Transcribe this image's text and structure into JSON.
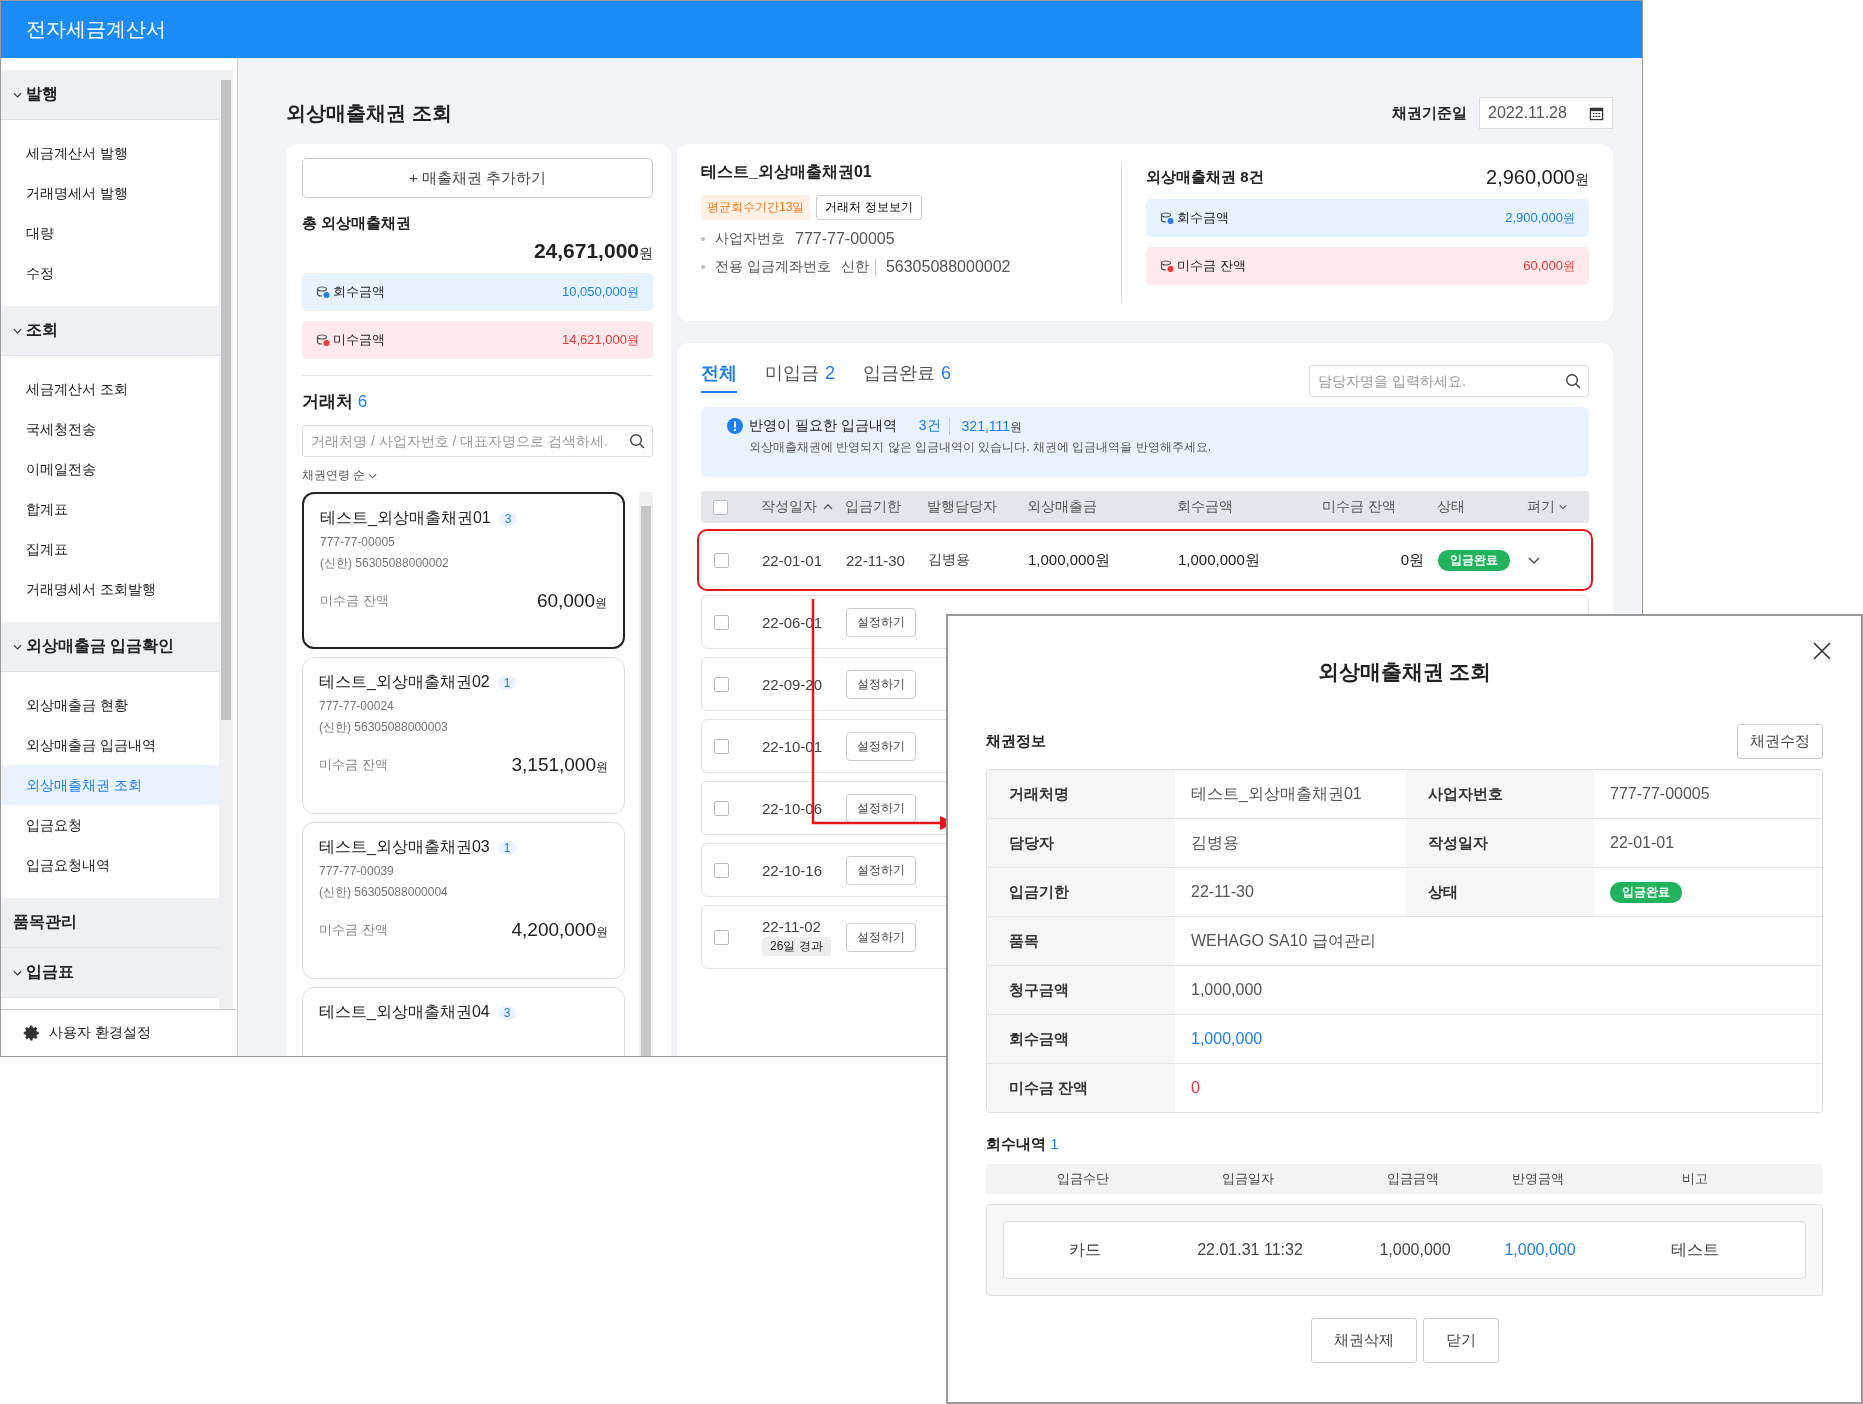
{
  "app": {
    "title": "전자세금계산서"
  },
  "sidebar": {
    "sections": [
      {
        "label": "발행",
        "kind": "group",
        "children": [
          {
            "label": "세금계산서 발행",
            "selected": false
          },
          {
            "label": "거래명세서 발행",
            "selected": false
          },
          {
            "label": "대량",
            "selected": false
          },
          {
            "label": "수정",
            "selected": false
          }
        ]
      },
      {
        "label": "조회",
        "kind": "group",
        "children": [
          {
            "label": "세금계산서 조회",
            "selected": false
          },
          {
            "label": "국세청전송",
            "selected": false
          },
          {
            "label": "이메일전송",
            "selected": false
          },
          {
            "label": "합계표",
            "selected": false
          },
          {
            "label": "집계표",
            "selected": false
          },
          {
            "label": "거래명세서 조회발행",
            "selected": false
          }
        ]
      },
      {
        "label": "외상매출금 입금확인",
        "kind": "group",
        "children": [
          {
            "label": "외상매출금 현황",
            "selected": false
          },
          {
            "label": "외상매출금 입금내역",
            "selected": false
          },
          {
            "label": "외상매출채권 조회",
            "selected": true
          },
          {
            "label": "입금요청",
            "selected": false
          },
          {
            "label": "입금요청내역",
            "selected": false
          }
        ]
      },
      {
        "label": "품목관리",
        "kind": "link"
      },
      {
        "label": "입금표",
        "kind": "group"
      }
    ],
    "footer": "사용자 환경설정"
  },
  "page": {
    "title": "외상매출채권 조회",
    "date_label": "채권기준일",
    "date_value": "2022.11.28"
  },
  "left_panel": {
    "add_button": "+ 매출채권 추가하기",
    "total_label": "총 외상매출채권",
    "total_amount": "24,671,000",
    "unit": "원",
    "summaries": [
      {
        "kind": "collected",
        "label": "회수금액",
        "amount": "10,050,000",
        "unit": "원"
      },
      {
        "kind": "outstanding",
        "label": "미수금액",
        "amount": "14,621,000",
        "unit": "원"
      }
    ],
    "clients_label": "거래처",
    "clients_count": "6",
    "search_placeholder": "거래처명 / 사업자번호 / 대표자명으로 검색하세.",
    "sort_label": "채권연령 순",
    "clients": [
      {
        "name": "테스트_외상매출채권01",
        "count": "3",
        "biz_no": "777-77-00005",
        "account": "(신한) 56305088000002",
        "balance_label": "미수금 잔액",
        "balance": "60,000",
        "unit": "원",
        "selected": true
      },
      {
        "name": "테스트_외상매출채권02",
        "count": "1",
        "biz_no": "777-77-00024",
        "account": "(신한) 56305088000003",
        "balance_label": "미수금 잔액",
        "balance": "3,151,000",
        "unit": "원",
        "selected": false
      },
      {
        "name": "테스트_외상매출채권03",
        "count": "1",
        "biz_no": "777-77-00039",
        "account": "(신한) 56305088000004",
        "balance_label": "미수금 잔액",
        "balance": "4,200,000",
        "unit": "원",
        "selected": false
      },
      {
        "name": "테스트_외상매출채권04",
        "count": "3",
        "selected": false
      }
    ]
  },
  "detail": {
    "name": "테스트_외상매출채권01",
    "badge": "평균회수기간13일",
    "info_button": "거래처 정보보기",
    "biz_label": "사업자번호",
    "biz_no": "777-77-00005",
    "account_label": "전용 입금계좌번호",
    "bank": "신한",
    "account": "56305088000002",
    "summary_title": "외상매출채권 8건",
    "summary_total": "2,960,000",
    "unit": "원",
    "summaries": [
      {
        "kind": "collected",
        "label": "회수금액",
        "amount": "2,900,000",
        "unit": "원"
      },
      {
        "kind": "outstanding",
        "label": "미수금 잔액",
        "amount": "60,000",
        "unit": "원"
      }
    ]
  },
  "list": {
    "tabs": [
      {
        "label": "전체",
        "selected": true
      },
      {
        "label": "미입금",
        "count": "2",
        "selected": false
      },
      {
        "label": "입금완료",
        "count": "6",
        "selected": false
      }
    ],
    "search_placeholder": "담당자명을 입력하세요.",
    "notice": {
      "title": "반영이 필요한 입금내역",
      "count": "3건",
      "amount": "321,111",
      "unit": "원",
      "text": "외상매출채권에 반영되지 않은 입금내역이 있습니다. 채권에 입금내역을 반영해주세요."
    },
    "header_checked": false,
    "columns": [
      {
        "label": "작성일자",
        "sorted": true
      },
      {
        "label": "입금기한"
      },
      {
        "label": "발행담당자"
      },
      {
        "label": "외상매출금"
      },
      {
        "label": "회수금액"
      },
      {
        "label": "미수금 잔액"
      },
      {
        "label": "상태"
      },
      {
        "label": "펴기",
        "expanded": false
      }
    ],
    "rows": [
      {
        "kind": "full",
        "checked": false,
        "selected": true,
        "date": "22-01-01",
        "due": "22-11-30",
        "manager": "김병용",
        "amount": "1,000,000원",
        "collected": "1,000,000원",
        "balance": "0원",
        "status": "입금완료",
        "expanded": false
      },
      {
        "kind": "partial",
        "checked": false,
        "selected": false,
        "date": "22-06-01",
        "action": "설정하기"
      },
      {
        "kind": "partial",
        "checked": false,
        "selected": false,
        "date": "22-09-20",
        "action": "설정하기"
      },
      {
        "kind": "partial",
        "checked": false,
        "selected": false,
        "date": "22-10-01",
        "action": "설정하기"
      },
      {
        "kind": "partial",
        "checked": false,
        "selected": false,
        "date": "22-10-06",
        "action": "설정하기"
      },
      {
        "kind": "partial",
        "checked": false,
        "selected": false,
        "date": "22-10-16",
        "action": "설정하기"
      },
      {
        "kind": "partial",
        "checked": false,
        "selected": false,
        "date": "22-11-02",
        "elapsed": "26일 경과",
        "action": "설정하기"
      }
    ]
  },
  "modal": {
    "title": "외상매출채권 조회",
    "section": "채권정보",
    "edit_button": "채권수정",
    "info_rows": [
      [
        {
          "label": "거래처명",
          "value": "테스트_외상매출채권01"
        },
        {
          "label": "사업자번호",
          "value": "777-77-00005"
        }
      ],
      [
        {
          "label": "담당자",
          "value": "김병용"
        },
        {
          "label": "작성일자",
          "value": "22-01-01"
        }
      ],
      [
        {
          "label": "입금기한",
          "value": "22-11-30"
        },
        {
          "label": "상태",
          "value": "입금완료",
          "kind": "status"
        }
      ],
      [
        {
          "label": "품목",
          "value": "WEHAGO SA10 급여관리"
        }
      ],
      [
        {
          "label": "청구금액",
          "value": "1,000,000"
        }
      ],
      [
        {
          "label": "회수금액",
          "value": "1,000,000",
          "kind": "collected"
        }
      ],
      [
        {
          "label": "미수금 잔액",
          "value": "0",
          "kind": "outstanding"
        }
      ]
    ],
    "history_title": "회수내역",
    "history_count": "1",
    "history_columns": [
      "입금수단",
      "입금일자",
      "입금금액",
      "반영금액",
      "비고"
    ],
    "history_rows": [
      {
        "method": "카드",
        "date": "22.01.31 11:32",
        "amount": "1,000,000",
        "applied": "1,000,000",
        "note": "테스트"
      }
    ],
    "buttons": [
      "채권삭제",
      "닫기"
    ]
  }
}
